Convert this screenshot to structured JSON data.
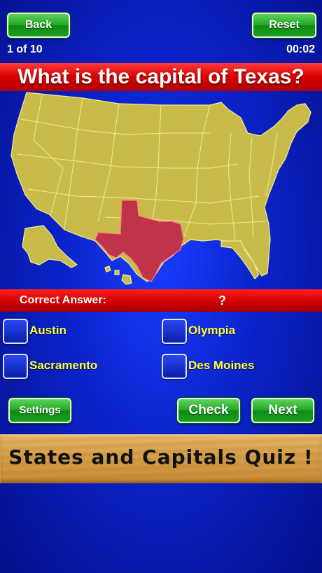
{
  "header": {
    "back_label": "Back",
    "reset_label": "Reset",
    "progress_text": "1 of 10",
    "timer_text": "00:02"
  },
  "question": {
    "text": "What is the capital of Texas?"
  },
  "map": {
    "highlighted_state": "Texas",
    "state_color": "#c9bb4a",
    "highlight_color": "#c0344a"
  },
  "answer": {
    "label": "Correct Answer:",
    "value": "?"
  },
  "options": [
    {
      "label": "Austin"
    },
    {
      "label": "Olympia"
    },
    {
      "label": "Sacramento"
    },
    {
      "label": "Des Moines"
    }
  ],
  "controls": {
    "settings_label": "Settings",
    "check_label": "Check",
    "next_label": "Next"
  },
  "footer": {
    "title": "States and Capitals Quiz !"
  }
}
